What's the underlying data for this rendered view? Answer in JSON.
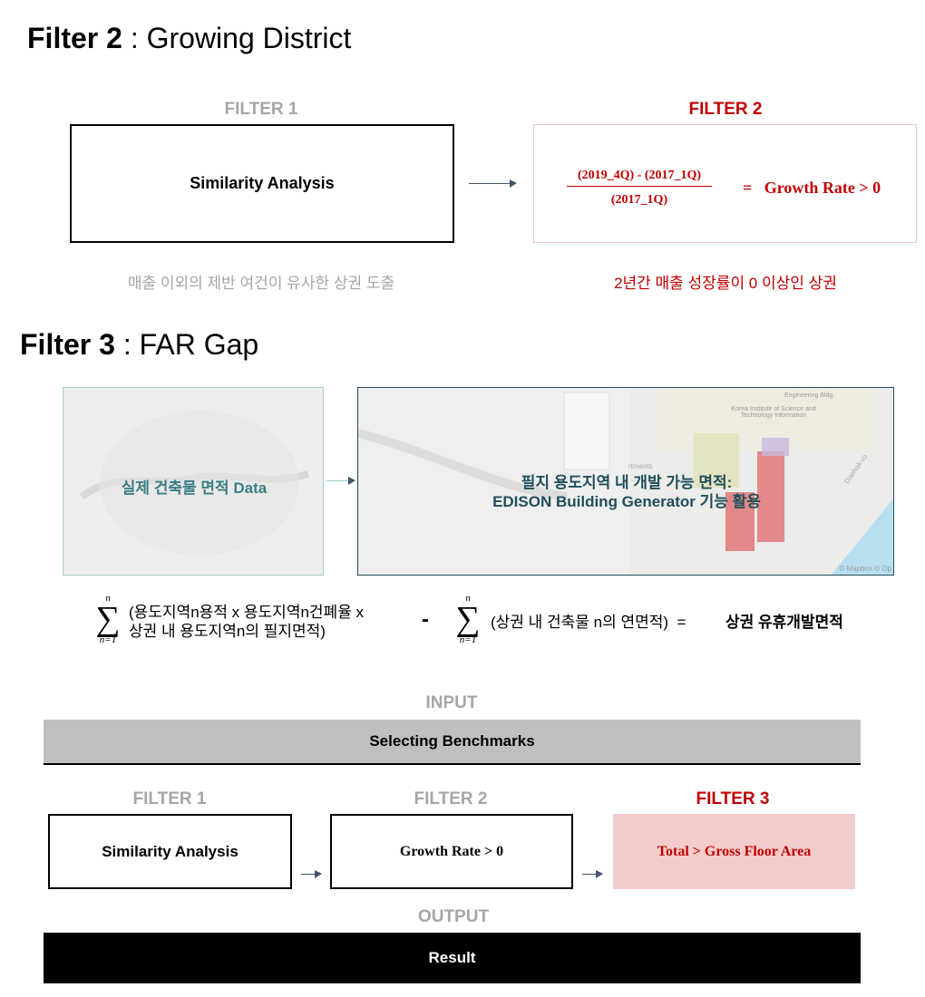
{
  "filter2_section": {
    "title_bold": "Filter 2",
    "title_rest": " : Growing District",
    "filter1": {
      "label": "FILTER 1",
      "box": "Similarity Analysis",
      "description": "매출 이외의 제반 여건이 유사한 상권 도출"
    },
    "filter2": {
      "label": "FILTER 2",
      "numerator": "(2019_4Q) - (2017_1Q)",
      "denominator": "(2017_1Q)",
      "result": "=   Growth Rate > 0",
      "description": "2년간 매출 성장률이 0 이상인 상권"
    }
  },
  "filter3_section": {
    "title_bold": "Filter 3",
    "title_rest": " : FAR Gap",
    "map_left_caption": "실제 건축물 면적 Data",
    "map_right_caption_line1": "필지 용도지역 내 개발 가능 면적:",
    "map_right_caption_line2": "EDISON Building Generator 기능 활용",
    "map_attribution": "© Mapbox © Op",
    "map_labels": [
      "Korea Institute of Science and Technology Information",
      "Daehak-ro",
      "Engineering Bldg.",
      "rtments"
    ],
    "formula": {
      "sigma_top": "n",
      "sigma_bottom": "n=1",
      "term1_line1": "(용도지역n용적 x 용도지역n건폐율 x",
      "term1_line2": "상권 내 용도지역n의 필지면적)",
      "minus": "-",
      "term2": "(상권 내 건축물 n의 연면적)  =",
      "result": "상권 유휴개발면적"
    }
  },
  "pipeline": {
    "input_label": "INPUT",
    "input_bar": "Selecting Benchmarks",
    "filters": [
      {
        "label": "FILTER 1",
        "box": "Similarity Analysis"
      },
      {
        "label": "FILTER 2",
        "box": "Growth Rate > 0"
      },
      {
        "label": "FILTER 3",
        "box": "Total > Gross Floor Area"
      }
    ],
    "output_label": "OUTPUT",
    "output_bar": "Result"
  },
  "colors": {
    "accent_red": "#c00000",
    "teal": "#1f4e5a",
    "pink_fill": "#f4cccc",
    "input_gray": "#bfbfbf"
  }
}
